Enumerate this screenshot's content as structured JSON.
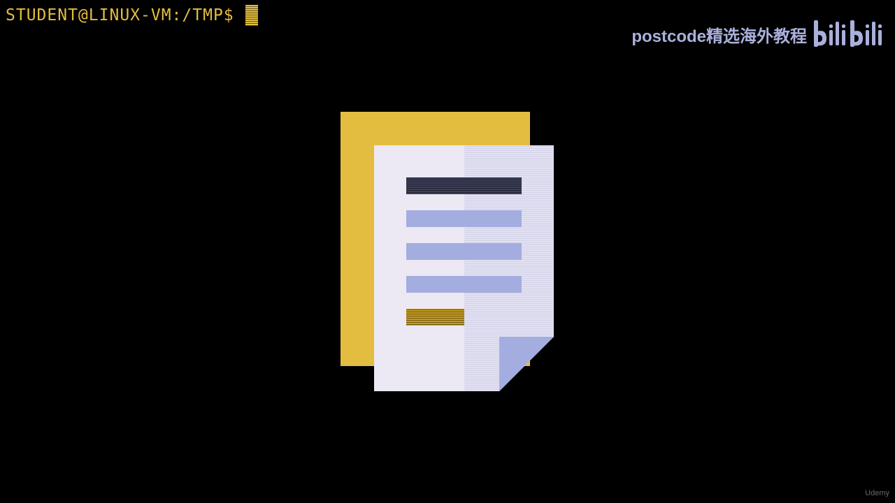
{
  "terminal": {
    "prompt": "STUDENT@LINUX-VM:/TMP$"
  },
  "watermark": {
    "channel_text": "postcode精选海外教程",
    "logo_text": "bilibili"
  },
  "footer": {
    "brand_text": "Udemy"
  },
  "illustration": {
    "name": "document-icon",
    "colors": {
      "back_page": "#e3bd3f",
      "front_page": "#ece8f4",
      "front_page_shade": "#e2e1f3",
      "title_bar": "#3c3f5a",
      "text_lines": "#a4addf",
      "accent_bar": "#c99e1e",
      "page_fold": "#a4addf"
    }
  }
}
